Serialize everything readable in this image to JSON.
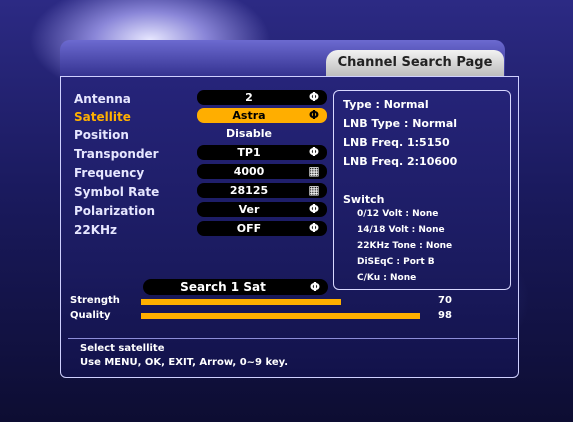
{
  "page": {
    "title": "Channel Search Page"
  },
  "settings": [
    {
      "label": "Antenna",
      "value": "2",
      "icon": "satellite-dish-icon",
      "boxed": true,
      "active": false
    },
    {
      "label": "Satellite",
      "value": "Astra",
      "icon": "satellite-dish-icon",
      "boxed": true,
      "active": true
    },
    {
      "label": "Position",
      "value": "Disable",
      "icon": "",
      "boxed": false,
      "active": false
    },
    {
      "label": "Transponder",
      "value": "TP1",
      "icon": "satellite-dish-icon",
      "boxed": true,
      "active": false
    },
    {
      "label": "Frequency",
      "value": "4000",
      "icon": "numeric-keypad-icon",
      "boxed": true,
      "active": false
    },
    {
      "label": "Symbol Rate",
      "value": "28125",
      "icon": "numeric-keypad-icon",
      "boxed": true,
      "active": false
    },
    {
      "label": "Polarization",
      "value": "Ver",
      "icon": "satellite-dish-icon",
      "boxed": true,
      "active": false
    },
    {
      "label": "22KHz",
      "value": "OFF",
      "icon": "satellite-dish-icon",
      "boxed": true,
      "active": false
    }
  ],
  "info": {
    "type": "Type : Normal",
    "lnb_type": "LNB Type : Normal",
    "lnb_freq1": "LNB Freq. 1:5150",
    "lnb_freq2": "LNB Freq. 2:10600",
    "switch_title": "Switch",
    "switch_items": [
      "0/12 Volt : None",
      "14/18 Volt : None",
      "22KHz Tone : None",
      "DiSEqC : Port B",
      "C/Ku : None"
    ]
  },
  "search": {
    "label": "Search 1 Sat",
    "icon": "satellite-dish-icon"
  },
  "meters": {
    "strength_label": "Strength",
    "strength_value": "70",
    "strength_level": 0.7,
    "quality_label": "Quality",
    "quality_value": "98",
    "quality_level": 0.98
  },
  "help": {
    "line1": "Select satellite",
    "line2": "Use MENU, OK, EXIT, Arrow, 0~9 key."
  },
  "colors": {
    "accent": "#ffb000",
    "background": "#1b1b60"
  }
}
